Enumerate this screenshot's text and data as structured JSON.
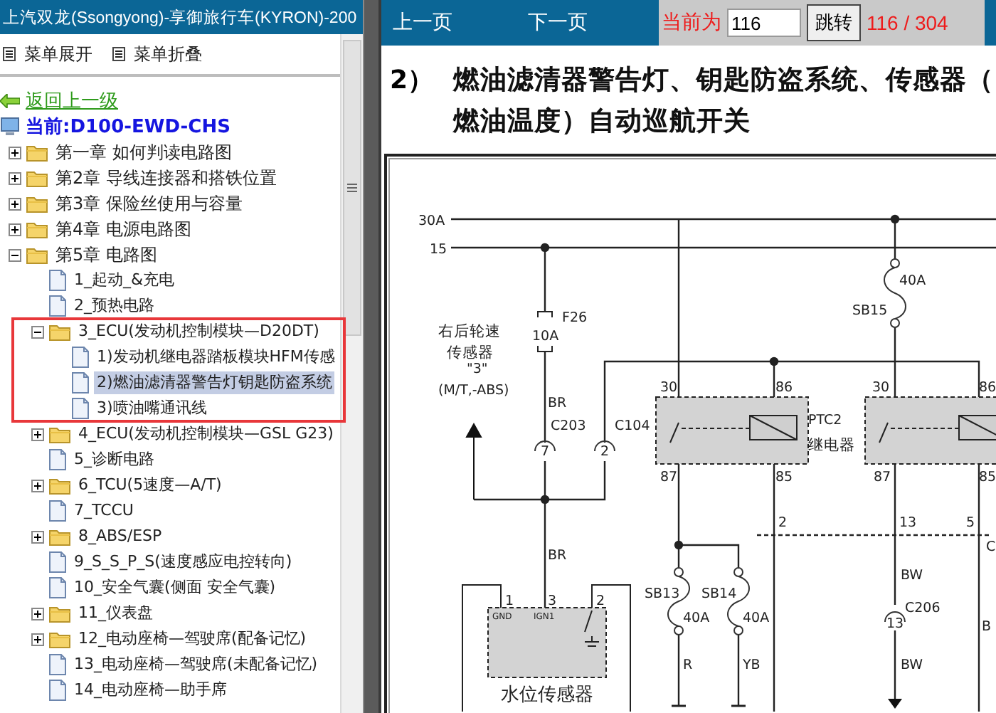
{
  "window": {
    "title": "上汽双龙(Ssongyong)-享御旅行车(KYRON)-200"
  },
  "menu_buttons": [
    "菜单展开",
    "菜单折叠"
  ],
  "back_link": "返回上一级",
  "current": "当前:D100-EWD-CHS",
  "tree": [
    {
      "label": "第一章 如何判读电路图",
      "kind": "folder",
      "expanded": false,
      "selected": false
    },
    {
      "label": "第2章 导线连接器和搭铁位置",
      "kind": "folder",
      "expanded": false,
      "selected": false
    },
    {
      "label": "第3章 保险丝使用与容量",
      "kind": "folder",
      "expanded": false,
      "selected": false
    },
    {
      "label": "第4章 电源电路图",
      "kind": "folder",
      "expanded": false,
      "selected": false
    },
    {
      "label": "第5章 电路图",
      "kind": "folder",
      "expanded": true,
      "selected": false,
      "children": [
        {
          "label": "1_起动_&充电",
          "kind": "page",
          "selected": false
        },
        {
          "label": "2_预热电路",
          "kind": "page",
          "selected": false
        },
        {
          "label": "3_ECU(发动机控制模块—D20DT)",
          "kind": "folder",
          "expanded": true,
          "selected": false,
          "children": [
            {
              "label": "1)发动机继电器踏板模块HFM传感",
              "kind": "page",
              "selected": false
            },
            {
              "label": "2)燃油滤清器警告灯钥匙防盗系统",
              "kind": "page",
              "selected": true
            },
            {
              "label": "3)喷油嘴通讯线",
              "kind": "page",
              "selected": false
            }
          ]
        },
        {
          "label": "4_ECU(发动机控制模块—GSL G23)",
          "kind": "folder",
          "expanded": false,
          "selected": false
        },
        {
          "label": "5_诊断电路",
          "kind": "page",
          "selected": false
        },
        {
          "label": "6_TCU(5速度—A/T)",
          "kind": "folder",
          "expanded": false,
          "selected": false
        },
        {
          "label": "7_TCCU",
          "kind": "page",
          "selected": false
        },
        {
          "label": "8_ABS/ESP",
          "kind": "folder",
          "expanded": false,
          "selected": false
        },
        {
          "label": "9_S_S_P_S(速度感应电控转向)",
          "kind": "page",
          "selected": false
        },
        {
          "label": "10_安全气囊(侧面 安全气囊)",
          "kind": "page",
          "selected": false
        },
        {
          "label": "11_仪表盘",
          "kind": "folder",
          "expanded": false,
          "selected": false
        },
        {
          "label": "12_电动座椅—驾驶席(配备记忆)",
          "kind": "folder",
          "expanded": false,
          "selected": false
        },
        {
          "label": "13_电动座椅—驾驶席(未配备记忆)",
          "kind": "page",
          "selected": false
        },
        {
          "label": "14_电动座椅—助手席",
          "kind": "page",
          "selected": false
        }
      ]
    }
  ],
  "pager": {
    "prev": "上一页",
    "next": "下一页",
    "current_label": "当前为",
    "page_value": "116",
    "go_button": "跳转",
    "page_count": "116 / 304"
  },
  "heading": {
    "number": "2）",
    "lines": [
      "燃油滤清器警告灯、钥匙防盗系统、传感器（",
      "燃油温度）自动巡航开关"
    ]
  },
  "diagram": {
    "labels": [
      "30A",
      "15",
      "40A",
      "SB15",
      "F26",
      "10A",
      "右后轮速",
      "传感器",
      "\"3\"",
      "(M/T,-ABS)",
      "30",
      "86",
      "30",
      "86",
      "BR",
      "C203",
      "C104",
      "PTC2",
      "7",
      "2",
      "继电器",
      "87",
      "85",
      "87",
      "85",
      "2",
      "13",
      "5",
      "C",
      "BR",
      "SB13",
      "SB14",
      "40A",
      "40A",
      "BW",
      "C206",
      "13",
      "B",
      "R",
      "YB",
      "BW",
      "1",
      "3",
      "2",
      "GND",
      "IGN1",
      "水位传感器"
    ]
  }
}
